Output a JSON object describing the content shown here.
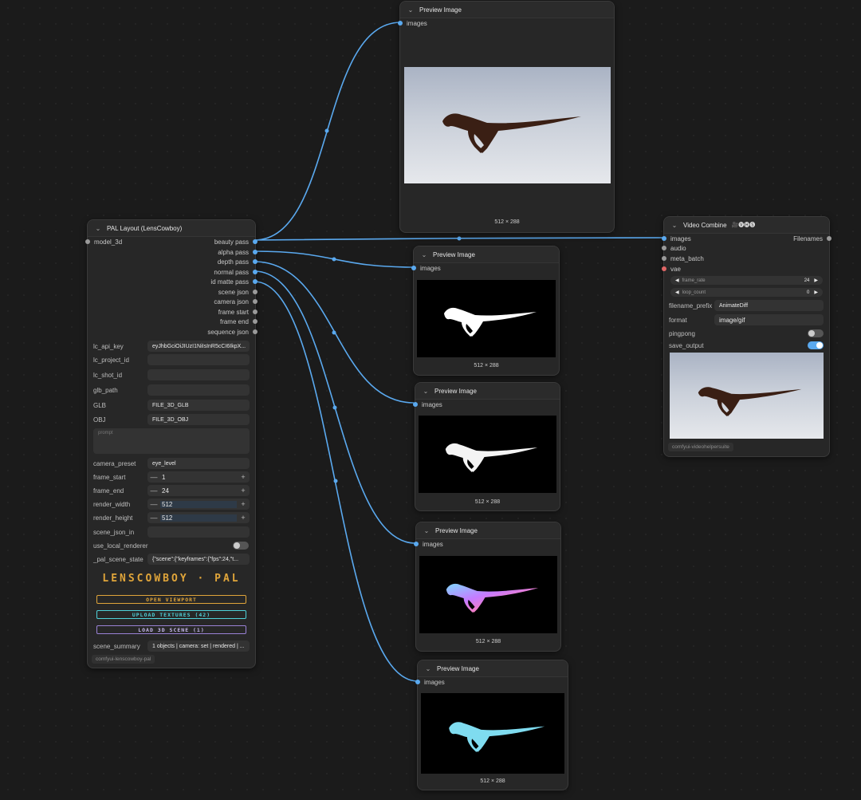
{
  "pal_node": {
    "title": "PAL Layout (LensCowboy)",
    "input": "model_3d",
    "outputs": [
      "beauty pass",
      "alpha pass",
      "depth pass",
      "normal pass",
      "id matte pass",
      "scene json",
      "camera json",
      "frame start",
      "frame end",
      "sequence json"
    ],
    "fields": [
      {
        "label": "lc_api_key",
        "value": "eyJhbGciOiJIUzI1NiIsInR5cCI6IkpX..."
      },
      {
        "label": "lc_project_id",
        "value": ""
      },
      {
        "label": "lc_shot_id",
        "value": ""
      },
      {
        "label": "glb_path",
        "value": ""
      },
      {
        "label": "GLB",
        "value": "FILE_3D_GLB"
      },
      {
        "label": "OBJ",
        "value": "FILE_3D_OBJ"
      }
    ],
    "prompt_placeholder": "prompt",
    "camera_preset": {
      "label": "camera_preset",
      "value": "eye_level"
    },
    "numbers": [
      {
        "label": "frame_start",
        "value": "1"
      },
      {
        "label": "frame_end",
        "value": "24"
      },
      {
        "label": "render_width",
        "value": "512"
      },
      {
        "label": "render_height",
        "value": "512"
      }
    ],
    "scene_json_in": {
      "label": "scene_json_in",
      "value": ""
    },
    "use_local_renderer": {
      "label": "use_local_renderer",
      "on": false
    },
    "pal_scene_state": {
      "label": "_pal_scene_state",
      "value": "{\"scene\":{\"keyframes\":{\"fps\":24,\"t..."
    },
    "banner": "LENSCOWBOY · PAL",
    "buttons": {
      "open": "OPEN VIEWPORT",
      "upload": "UPLOAD TEXTURES (42)",
      "load": "LOAD 3D SCENE (1)"
    },
    "scene_summary": {
      "label": "scene_summary",
      "value": "1 objects | camera: set | rendered | ..."
    },
    "footer_tag": "comfyui-lenscowboy-pal"
  },
  "preview_nodes": [
    {
      "title": "Preview Image",
      "input": "images",
      "size": "512 × 288"
    },
    {
      "title": "Preview Image",
      "input": "images",
      "size": "512 × 288"
    },
    {
      "title": "Preview Image",
      "input": "images",
      "size": "512 × 288"
    },
    {
      "title": "Preview Image",
      "input": "images",
      "size": "512 × 288"
    },
    {
      "title": "Preview Image",
      "input": "images",
      "size": "512 × 288"
    }
  ],
  "video_node": {
    "title": "Video Combine",
    "title_icons": "🎥🅥🅗🅢",
    "inputs": [
      "images",
      "audio",
      "meta_batch",
      "vae"
    ],
    "output": "Filenames",
    "frame_rate": {
      "label": "frame_rate",
      "value": "24"
    },
    "loop_count": {
      "label": "loop_count",
      "value": "0"
    },
    "filename_prefix": {
      "label": "filename_prefix",
      "value": "AnimateDiff"
    },
    "format": {
      "label": "format",
      "value": "image/gif"
    },
    "pingpong": {
      "label": "pingpong",
      "on": false
    },
    "save_output": {
      "label": "save_output",
      "on": true
    },
    "footer_tag": "comfyui-videohelpersuite"
  },
  "colors": {
    "wire": "#5aa9ef",
    "accent_gold": "#e0a53a",
    "accent_cyan": "#4fd1d9"
  }
}
